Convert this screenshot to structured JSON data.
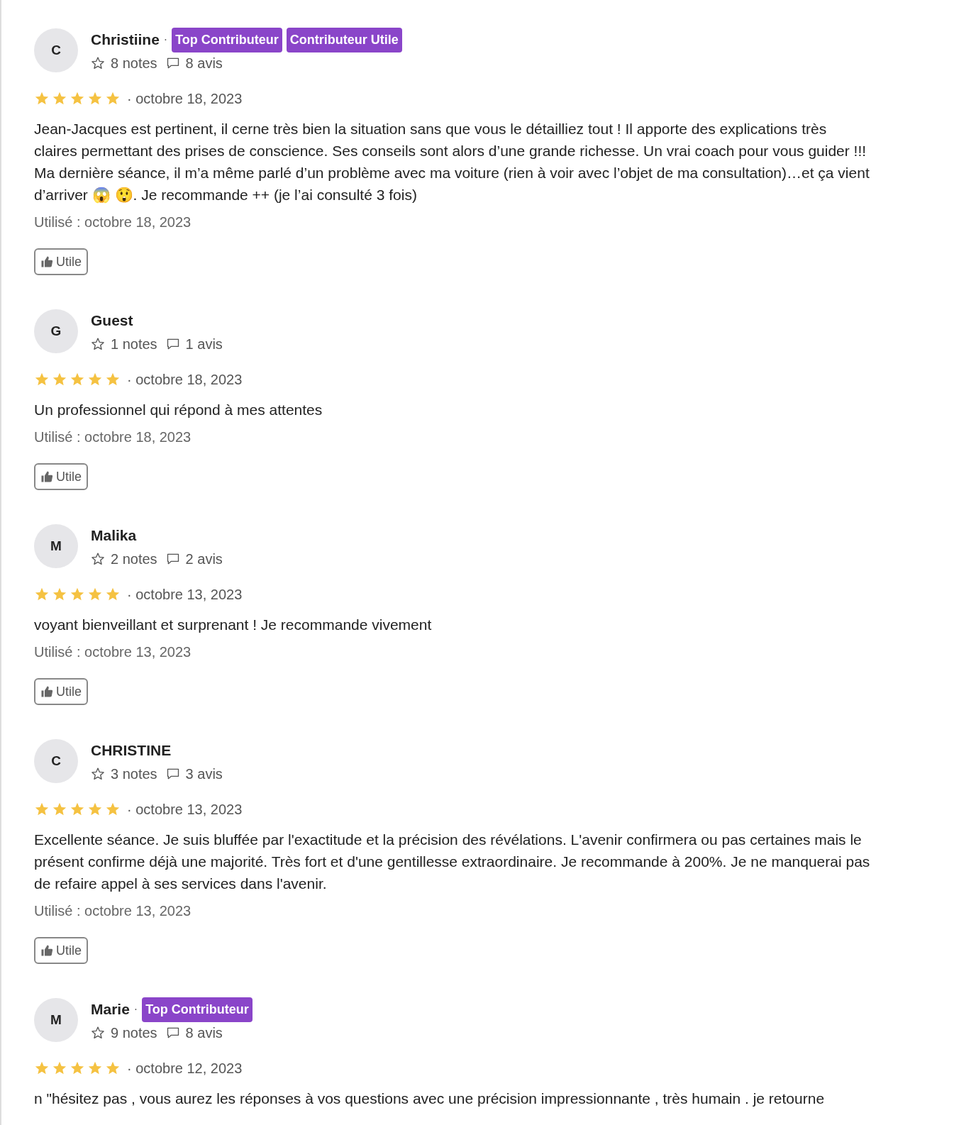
{
  "reviews": [
    {
      "avatar": "C",
      "name": "Christiine",
      "separator": "·",
      "badges": [
        "Top Contributeur",
        "Contributeur Utile"
      ],
      "notes": "8 notes",
      "avis": "8 avis",
      "stars": 5,
      "date": "· octobre 18, 2023",
      "text": "Jean-Jacques est pertinent, il cerne très bien la situation sans que vous le détailliez tout ! Il apporte des explications très claires permettant des prises de conscience. Ses conseils sont alors d’une grande richesse. Un vrai coach pour vous guider !!! Ma dernière séance, il m’a même parlé d’un problème avec ma voiture (rien à voir avec l’objet de ma consultation)…et ça vient d’arriver 😱 😲. Je recommande ++ (je l’ai consulté 3 fois)",
      "used": "Utilisé : octobre 18, 2023",
      "helpful": "Utile"
    },
    {
      "avatar": "G",
      "name": "Guest",
      "notes": "1 notes",
      "avis": "1 avis",
      "stars": 5,
      "date": "· octobre 18, 2023",
      "text": "Un professionnel qui répond à mes attentes",
      "used": "Utilisé : octobre 18, 2023",
      "helpful": "Utile"
    },
    {
      "avatar": "M",
      "name": "Malika",
      "notes": "2 notes",
      "avis": "2 avis",
      "stars": 5,
      "date": "· octobre 13, 2023",
      "text": "voyant bienveillant et surprenant ! Je recommande vivement",
      "used": "Utilisé : octobre 13, 2023",
      "helpful": "Utile"
    },
    {
      "avatar": "C",
      "name": "CHRISTINE",
      "notes": "3 notes",
      "avis": "3 avis",
      "stars": 5,
      "date": "· octobre 13, 2023",
      "text": "Excellente séance. Je suis bluffée par l'exactitude et la précision des révélations. L'avenir confirmera ou pas certaines mais le présent confirme déjà une majorité. Très fort et d'une gentillesse extraordinaire. Je recommande à 200%. Je ne manquerai pas de refaire appel à ses services dans l'avenir.",
      "used": "Utilisé : octobre 13, 2023",
      "helpful": "Utile"
    },
    {
      "avatar": "M",
      "name": "Marie",
      "separator": "·",
      "badges": [
        "Top Contributeur"
      ],
      "notes": "9 notes",
      "avis": "8 avis",
      "stars": 5,
      "date": "· octobre 12, 2023",
      "text": "n \"hésitez pas , vous aurez les réponses à vos questions avec une précision impressionnante , très humain . je retourne"
    }
  ]
}
